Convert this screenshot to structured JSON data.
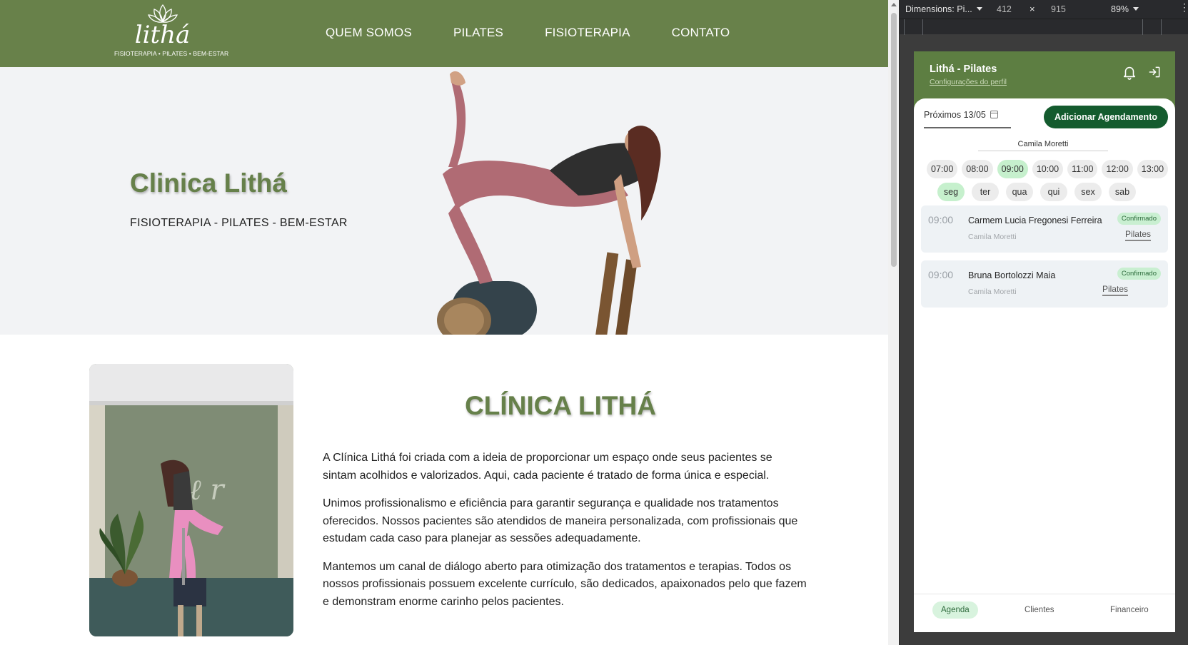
{
  "site": {
    "logo": {
      "word": "lithá",
      "tagline": "FISIOTERAPIA • PILATES • BEM-ESTAR"
    },
    "nav": [
      "QUEM SOMOS",
      "PILATES",
      "FISIOTERAPIA",
      "CONTATO"
    ],
    "hero": {
      "title": "Clinica Lithá",
      "subtitle": "FISIOTERAPIA - PILATES - BEM-ESTAR"
    },
    "about": {
      "title": "CLÍNICA LITHÁ",
      "paragraphs": [
        "A Clínica Lithá foi criada com a ideia de proporcionar um espaço onde seus pacientes se sintam acolhidos e valorizados. Aqui, cada paciente é tratado de forma única e especial.",
        "Unimos profissionalismo e eficiência para garantir segurança e qualidade nos tratamentos oferecidos. Nossos pacientes são atendidos de maneira personalizada, com profissionais que estudam cada caso para planejar as sessões adequadamente.",
        "Mantemos um canal de diálogo aberto para otimização dos tratamentos e terapias. Todos os nossos profissionais possuem excelente currículo, são dedicados, apaixonados pelo que fazem e demonstram enorme carinho pelos pacientes."
      ]
    }
  },
  "devtools": {
    "dimensions_label": "Dimensions: Pi...",
    "width": "412",
    "times_symbol": "×",
    "height": "915",
    "zoom": "89%",
    "more": "⋮"
  },
  "app": {
    "title": "Lithá - Pilates",
    "profile_link": "Configurações do perfil",
    "tab_label": "Próximos 13/05",
    "add_button": "Adicionar Agendamento",
    "professional": "Camila Moretti",
    "times": [
      "07:00",
      "08:00",
      "09:00",
      "10:00",
      "11:00",
      "12:00",
      "13:00"
    ],
    "active_time": "09:00",
    "days": [
      "seg",
      "ter",
      "qua",
      "qui",
      "sex",
      "sab"
    ],
    "active_day": "seg",
    "appointments": [
      {
        "time": "09:00",
        "patient": "Carmem Lucia Fregonesi Ferreira",
        "professional": "Camila Moretti",
        "status": "Confirmado",
        "service": "Pilates"
      },
      {
        "time": "09:00",
        "patient": "Bruna Bortolozzi Maia",
        "professional": "Camila Moretti",
        "status": "Confirmado",
        "service": "Pilates"
      }
    ],
    "bottom_nav": [
      "Agenda",
      "Clientes",
      "Financeiro"
    ],
    "active_bottom": "Agenda"
  },
  "colors": {
    "brand_green": "#68814a",
    "title_green": "#66804a",
    "button_green": "#145b2e",
    "chip_active": "#c6f0cd"
  }
}
